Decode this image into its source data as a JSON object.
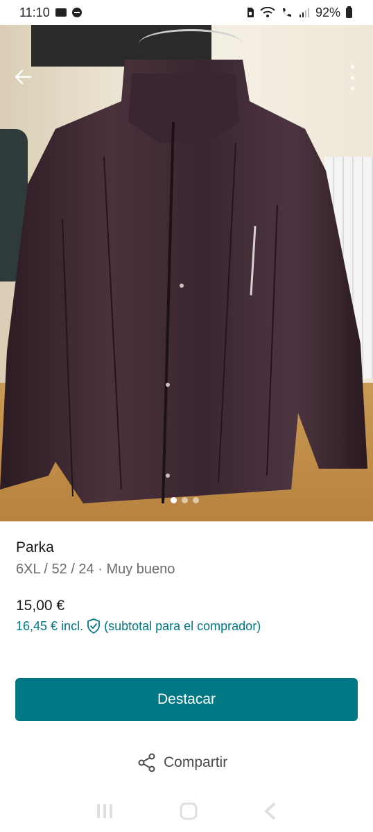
{
  "status_bar": {
    "time": "11:10",
    "battery": "92%",
    "icons": [
      "mail-icon",
      "do-not-disturb-icon",
      "sim-icon",
      "wifi-icon",
      "wifi-calling-icon",
      "signal-icon",
      "battery-icon"
    ]
  },
  "photo": {
    "icons": [
      "back-arrow-icon",
      "more-vertical-icon"
    ],
    "carousel": {
      "count": 3,
      "active_index": 0
    }
  },
  "item": {
    "title": "Parka",
    "details": "6XL / 52 / 24 · Muy bueno",
    "price": "15,00 €",
    "buyer_price": "16,45 €",
    "buyer_price_incl": "incl.",
    "buyer_price_note": "(subtotal para el comprador)"
  },
  "actions": {
    "promote_label": "Destacar",
    "share_label": "Compartir"
  },
  "colors": {
    "accent": "#007782",
    "jacket": "#3d2730"
  },
  "nav_bar": {
    "icons": [
      "recent-apps-icon",
      "home-icon",
      "back-icon"
    ]
  }
}
